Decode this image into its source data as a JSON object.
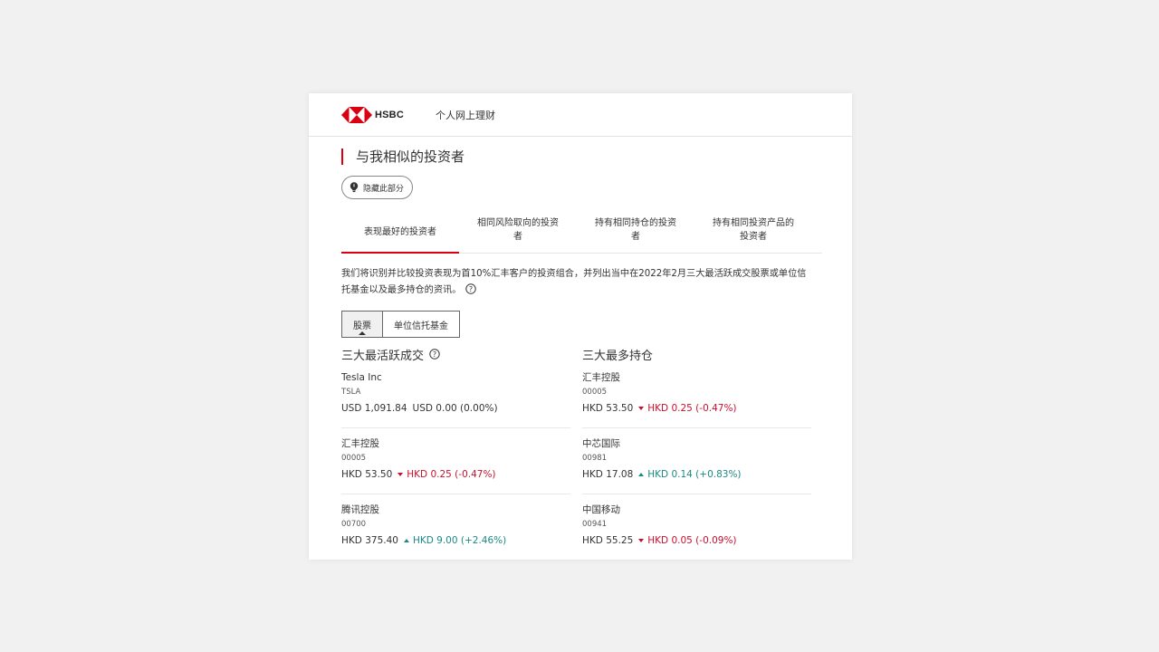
{
  "header": {
    "logo_text": "HSBC",
    "title": "个人网上理财"
  },
  "section": {
    "title": "与我相似的投资者",
    "hide_button": "隐藏此部分"
  },
  "tabs": [
    {
      "label_line1": "表现最好的投资者",
      "label_line2": "",
      "active": true
    },
    {
      "label_line1": "相同风险取向的投资",
      "label_line2": "者",
      "active": false
    },
    {
      "label_line1": "持有相同持仓的投资",
      "label_line2": "者",
      "active": false
    },
    {
      "label_line1": "持有相同投资产品的",
      "label_line2": "投资者",
      "active": false
    }
  ],
  "description": {
    "line1": "我们将识别并比较投资表现为首10%汇丰客户的投资组合，并列出当中在2022年2月三大最活跃成交股票或单位信",
    "line2": "托基金以及最多持仓的资讯。"
  },
  "segment": {
    "stocks": "股票",
    "funds": "单位信托基金"
  },
  "colors": {
    "brand_red": "#db0011",
    "down": "#c8102e",
    "up": "#1b8a85"
  },
  "most_active": {
    "title": "三大最活跃成交",
    "items": [
      {
        "name": "Tesla Inc",
        "code": "TSLA",
        "price": "USD 1,091.84",
        "change": "USD 0.00 (0.00%)",
        "direction": "flat"
      },
      {
        "name": "汇丰控股",
        "code": "00005",
        "price": "HKD 53.50",
        "change": "HKD 0.25 (-0.47%)",
        "direction": "down"
      },
      {
        "name": "腾讯控股",
        "code": "00700",
        "price": "HKD 375.40",
        "change": "HKD 9.00 (+2.46%)",
        "direction": "up"
      }
    ]
  },
  "most_held": {
    "title": "三大最多持仓",
    "items": [
      {
        "name": "汇丰控股",
        "code": "00005",
        "price": "HKD 53.50",
        "change": "HKD 0.25 (-0.47%)",
        "direction": "down"
      },
      {
        "name": "中芯国际",
        "code": "00981",
        "price": "HKD 17.08",
        "change": "HKD 0.14 (+0.83%)",
        "direction": "up"
      },
      {
        "name": "中国移动",
        "code": "00941",
        "price": "HKD 55.25",
        "change": "HKD 0.05 (-0.09%)",
        "direction": "down"
      }
    ]
  }
}
